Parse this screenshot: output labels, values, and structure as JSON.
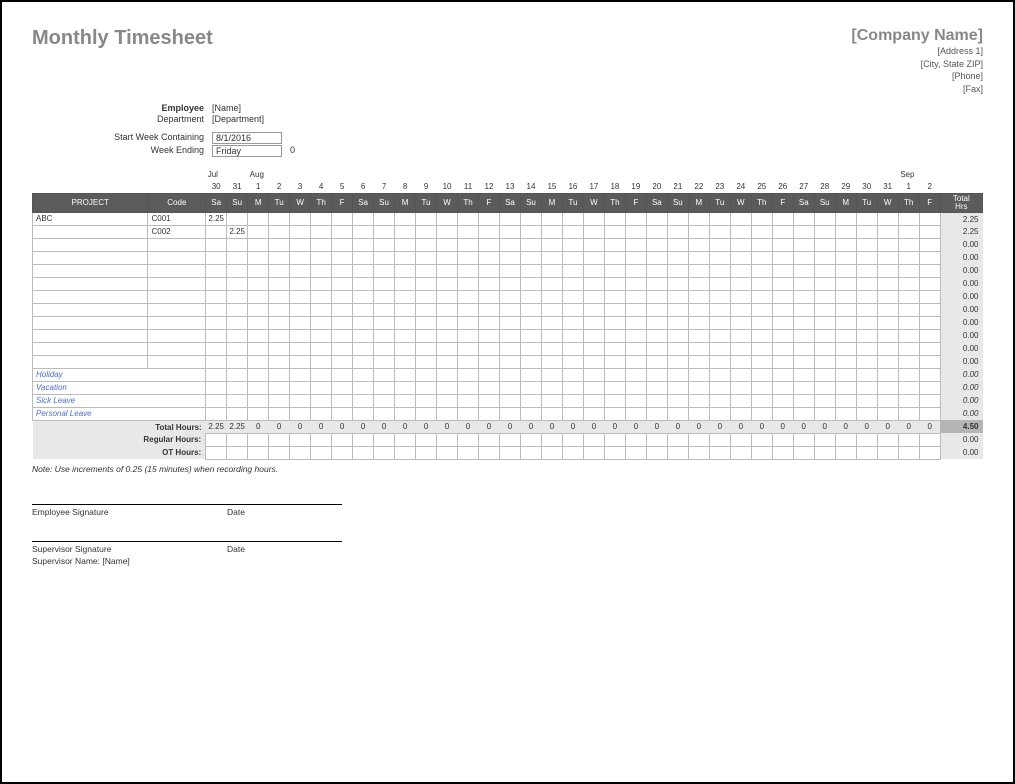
{
  "title": "Monthly Timesheet",
  "company": {
    "name": "[Company Name]",
    "address1": "[Address 1]",
    "citystatezip": "[City, State ZIP]",
    "phone": "[Phone]",
    "fax": "[Fax]"
  },
  "meta": {
    "employee_label": "Employee",
    "employee_value": "[Name]",
    "department_label": "Department",
    "department_value": "[Department]",
    "startweek_label": "Start Week Containing",
    "startweek_value": "8/1/2016",
    "weekending_label": "Week Ending",
    "weekending_value": "Friday",
    "weekending_extra": "0"
  },
  "months": [
    {
      "label": "Jul",
      "span_from": 0
    },
    {
      "label": "Aug",
      "span_from": 2
    },
    {
      "label": "Sep",
      "span_from": 33
    }
  ],
  "daynums": [
    "30",
    "31",
    "1",
    "2",
    "3",
    "4",
    "5",
    "6",
    "7",
    "8",
    "9",
    "10",
    "11",
    "12",
    "13",
    "14",
    "15",
    "16",
    "17",
    "18",
    "19",
    "20",
    "21",
    "22",
    "23",
    "24",
    "25",
    "26",
    "27",
    "28",
    "29",
    "30",
    "31",
    "1",
    "2"
  ],
  "dow": [
    "Sa",
    "Su",
    "M",
    "Tu",
    "W",
    "Th",
    "F",
    "Sa",
    "Su",
    "M",
    "Tu",
    "W",
    "Th",
    "F",
    "Sa",
    "Su",
    "M",
    "Tu",
    "W",
    "Th",
    "F",
    "Sa",
    "Su",
    "M",
    "Tu",
    "W",
    "Th",
    "F",
    "Sa",
    "Su",
    "M",
    "Tu",
    "W",
    "Th",
    "F"
  ],
  "head": {
    "project": "PROJECT",
    "code": "Code",
    "total_hrs": "Total Hrs"
  },
  "rows": [
    {
      "project": "ABC",
      "code": "C001",
      "cells": [
        "2.25",
        "",
        "",
        "",
        "",
        "",
        "",
        "",
        "",
        "",
        "",
        "",
        "",
        "",
        "",
        "",
        "",
        "",
        "",
        "",
        "",
        "",
        "",
        "",
        "",
        "",
        "",
        "",
        "",
        "",
        "",
        "",
        "",
        "",
        ""
      ],
      "total": "2.25"
    },
    {
      "project": "",
      "code": "C002",
      "cells": [
        "",
        "2.25",
        "",
        "",
        "",
        "",
        "",
        "",
        "",
        "",
        "",
        "",
        "",
        "",
        "",
        "",
        "",
        "",
        "",
        "",
        "",
        "",
        "",
        "",
        "",
        "",
        "",
        "",
        "",
        "",
        "",
        "",
        "",
        "",
        ""
      ],
      "total": "2.25"
    },
    {
      "project": "",
      "code": "",
      "cells": [
        "",
        "",
        "",
        "",
        "",
        "",
        "",
        "",
        "",
        "",
        "",
        "",
        "",
        "",
        "",
        "",
        "",
        "",
        "",
        "",
        "",
        "",
        "",
        "",
        "",
        "",
        "",
        "",
        "",
        "",
        "",
        "",
        "",
        "",
        ""
      ],
      "total": "0.00"
    },
    {
      "project": "",
      "code": "",
      "cells": [
        "",
        "",
        "",
        "",
        "",
        "",
        "",
        "",
        "",
        "",
        "",
        "",
        "",
        "",
        "",
        "",
        "",
        "",
        "",
        "",
        "",
        "",
        "",
        "",
        "",
        "",
        "",
        "",
        "",
        "",
        "",
        "",
        "",
        "",
        ""
      ],
      "total": "0.00"
    },
    {
      "project": "",
      "code": "",
      "cells": [
        "",
        "",
        "",
        "",
        "",
        "",
        "",
        "",
        "",
        "",
        "",
        "",
        "",
        "",
        "",
        "",
        "",
        "",
        "",
        "",
        "",
        "",
        "",
        "",
        "",
        "",
        "",
        "",
        "",
        "",
        "",
        "",
        "",
        "",
        ""
      ],
      "total": "0.00"
    },
    {
      "project": "",
      "code": "",
      "cells": [
        "",
        "",
        "",
        "",
        "",
        "",
        "",
        "",
        "",
        "",
        "",
        "",
        "",
        "",
        "",
        "",
        "",
        "",
        "",
        "",
        "",
        "",
        "",
        "",
        "",
        "",
        "",
        "",
        "",
        "",
        "",
        "",
        "",
        "",
        ""
      ],
      "total": "0.00"
    },
    {
      "project": "",
      "code": "",
      "cells": [
        "",
        "",
        "",
        "",
        "",
        "",
        "",
        "",
        "",
        "",
        "",
        "",
        "",
        "",
        "",
        "",
        "",
        "",
        "",
        "",
        "",
        "",
        "",
        "",
        "",
        "",
        "",
        "",
        "",
        "",
        "",
        "",
        "",
        "",
        ""
      ],
      "total": "0.00"
    },
    {
      "project": "",
      "code": "",
      "cells": [
        "",
        "",
        "",
        "",
        "",
        "",
        "",
        "",
        "",
        "",
        "",
        "",
        "",
        "",
        "",
        "",
        "",
        "",
        "",
        "",
        "",
        "",
        "",
        "",
        "",
        "",
        "",
        "",
        "",
        "",
        "",
        "",
        "",
        "",
        ""
      ],
      "total": "0.00"
    },
    {
      "project": "",
      "code": "",
      "cells": [
        "",
        "",
        "",
        "",
        "",
        "",
        "",
        "",
        "",
        "",
        "",
        "",
        "",
        "",
        "",
        "",
        "",
        "",
        "",
        "",
        "",
        "",
        "",
        "",
        "",
        "",
        "",
        "",
        "",
        "",
        "",
        "",
        "",
        "",
        ""
      ],
      "total": "0.00"
    },
    {
      "project": "",
      "code": "",
      "cells": [
        "",
        "",
        "",
        "",
        "",
        "",
        "",
        "",
        "",
        "",
        "",
        "",
        "",
        "",
        "",
        "",
        "",
        "",
        "",
        "",
        "",
        "",
        "",
        "",
        "",
        "",
        "",
        "",
        "",
        "",
        "",
        "",
        "",
        "",
        ""
      ],
      "total": "0.00"
    },
    {
      "project": "",
      "code": "",
      "cells": [
        "",
        "",
        "",
        "",
        "",
        "",
        "",
        "",
        "",
        "",
        "",
        "",
        "",
        "",
        "",
        "",
        "",
        "",
        "",
        "",
        "",
        "",
        "",
        "",
        "",
        "",
        "",
        "",
        "",
        "",
        "",
        "",
        "",
        "",
        ""
      ],
      "total": "0.00"
    },
    {
      "project": "",
      "code": "",
      "cells": [
        "",
        "",
        "",
        "",
        "",
        "",
        "",
        "",
        "",
        "",
        "",
        "",
        "",
        "",
        "",
        "",
        "",
        "",
        "",
        "",
        "",
        "",
        "",
        "",
        "",
        "",
        "",
        "",
        "",
        "",
        "",
        "",
        "",
        "",
        ""
      ],
      "total": "0.00"
    }
  ],
  "category_rows": [
    {
      "project": "Holiday",
      "total": "0.00"
    },
    {
      "project": "Vacation",
      "total": "0.00"
    },
    {
      "project": "Sick Leave",
      "total": "0.00"
    },
    {
      "project": "Personal Leave",
      "total": "0.00"
    }
  ],
  "totals": {
    "total_hours_label": "Total Hours:",
    "total_hours": [
      "2.25",
      "2.25",
      "0",
      "0",
      "0",
      "0",
      "0",
      "0",
      "0",
      "0",
      "0",
      "0",
      "0",
      "0",
      "0",
      "0",
      "0",
      "0",
      "0",
      "0",
      "0",
      "0",
      "0",
      "0",
      "0",
      "0",
      "0",
      "0",
      "0",
      "0",
      "0",
      "0",
      "0",
      "0",
      "0"
    ],
    "total_hours_sum": "4.50",
    "regular_label": "Regular Hours:",
    "regular_sum": "0.00",
    "ot_label": "OT Hours:",
    "ot_sum": "0.00"
  },
  "note": "Note: Use increments of 0.25 (15 minutes) when recording hours.",
  "sig": {
    "emp_sig": "Employee Signature",
    "date": "Date",
    "sup_sig": "Supervisor Signature",
    "sup_name_label": "Supervisor Name: [Name]"
  }
}
